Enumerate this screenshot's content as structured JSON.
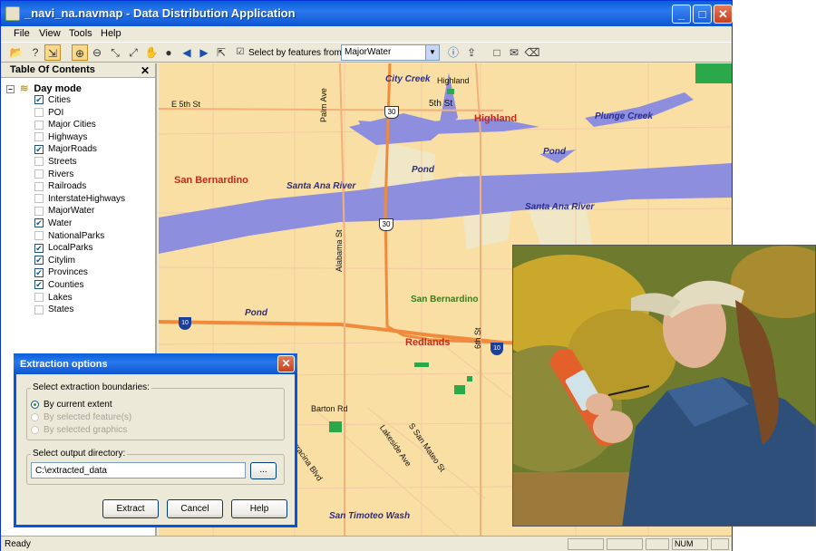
{
  "window": {
    "title": "_navi_na.navmap - Data Distribution Application",
    "controls": {
      "minimize": "_",
      "maximize": "□",
      "close": "✕"
    }
  },
  "menu": [
    "File",
    "View",
    "Tools",
    "Help"
  ],
  "toolbar": {
    "select_label": "Select by features from:",
    "select_value": "MajorWater"
  },
  "toc": {
    "title": "Table Of Contents",
    "close": "✕",
    "root": "Day mode",
    "layers": [
      {
        "name": "Cities",
        "checked": true
      },
      {
        "name": "POI",
        "checked": false
      },
      {
        "name": "Major Cities",
        "checked": false
      },
      {
        "name": "Highways",
        "checked": false
      },
      {
        "name": "MajorRoads",
        "checked": true
      },
      {
        "name": "Streets",
        "checked": false
      },
      {
        "name": "Rivers",
        "checked": false
      },
      {
        "name": "Railroads",
        "checked": false
      },
      {
        "name": "InterstateHighways",
        "checked": false
      },
      {
        "name": "MajorWater",
        "checked": false
      },
      {
        "name": "Water",
        "checked": true
      },
      {
        "name": "NationalParks",
        "checked": false
      },
      {
        "name": "LocalParks",
        "checked": true
      },
      {
        "name": "Citylim",
        "checked": true
      },
      {
        "name": "Provinces",
        "checked": true
      },
      {
        "name": "Counties",
        "checked": true
      },
      {
        "name": "Lakes",
        "checked": false
      },
      {
        "name": "States",
        "checked": false
      }
    ]
  },
  "map": {
    "labels": {
      "e5th": "E 5th St",
      "palm": "Palm Ave",
      "citycreek": "City Creek",
      "highland_small": "Highland",
      "fifth": "5th St",
      "highland": "Highland",
      "plunge": "Plunge Creek",
      "pond1": "Pond",
      "pond2": "Pond",
      "pond3": "Pond",
      "sanbern": "San Bernardino",
      "santaana1": "Santa Ana River",
      "santaana2": "Santa Ana River",
      "alabama": "Alabama St",
      "sanbern_park": "San Bernardino",
      "redlands": "Redlands",
      "sixth": "6th St",
      "barton": "Barton Rd",
      "terracina": "Terracina Blvd",
      "lakeside": "Lakeside Ave",
      "sanmateo": "S San Mateo St",
      "timoteo": "San Timoteo Wash"
    },
    "shields": {
      "hw30a": "30",
      "hw30b": "30",
      "i10a": "10",
      "i10b": "10"
    }
  },
  "dialog": {
    "title": "Extraction options",
    "close": "✕",
    "group1_label": "Select extraction boundaries:",
    "radios": [
      {
        "label": "By current extent",
        "selected": true,
        "enabled": true
      },
      {
        "label": "By selected feature(s)",
        "selected": false,
        "enabled": false
      },
      {
        "label": "By selected graphics",
        "selected": false,
        "enabled": false
      }
    ],
    "group2_label": "Select output directory:",
    "directory": "C:\\extracted_data",
    "browse": "...",
    "buttons": {
      "extract": "Extract",
      "cancel": "Cancel",
      "help": "Help"
    }
  },
  "status": {
    "text": "Ready",
    "num": "NUM"
  },
  "colors": {
    "titlebar": "#0a5fd8",
    "map_bg": "#f9dfa3",
    "water": "#8e8ede",
    "highway": "#f08a3c",
    "park": "#2aa84a",
    "city_label": "#c32a1c"
  }
}
